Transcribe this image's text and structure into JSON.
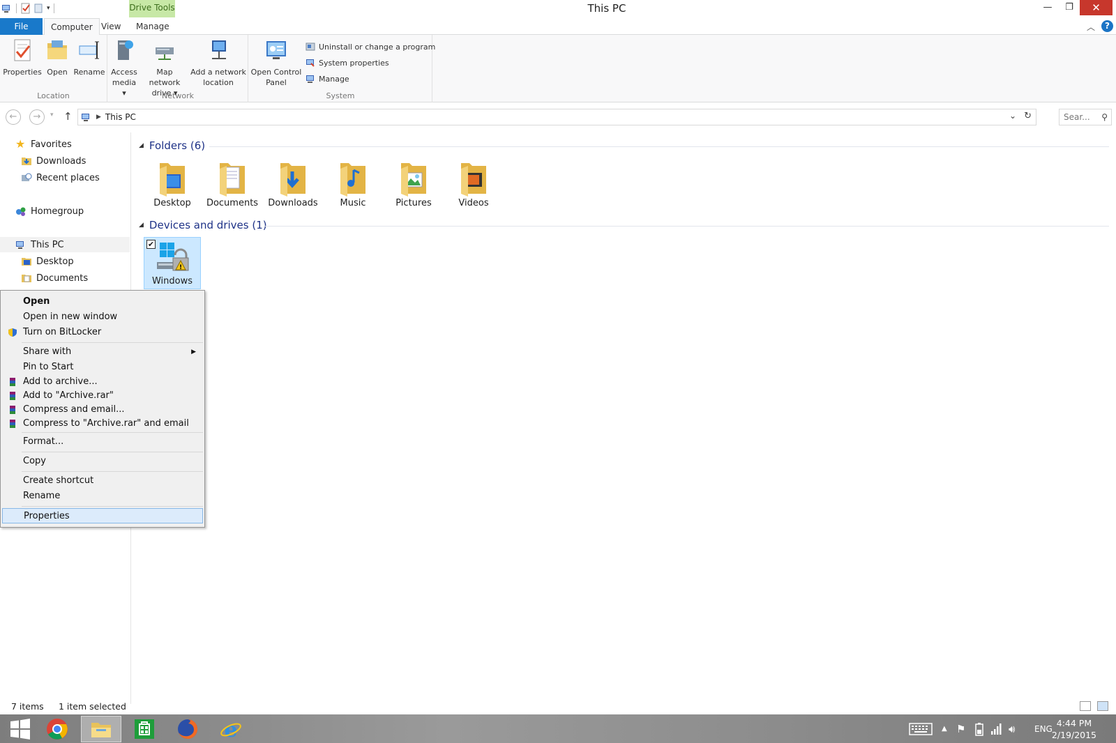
{
  "window": {
    "title": "This PC",
    "context_tab": "Drive Tools",
    "min_glyph": "—",
    "max_glyph": "❐",
    "close_glyph": "✕"
  },
  "ribbon_tabs": {
    "file": "File",
    "computer": "Computer",
    "view": "View",
    "manage": "Manage"
  },
  "ribbon": {
    "location": {
      "label": "Location",
      "properties": "Properties",
      "open": "Open",
      "rename": "Rename"
    },
    "network": {
      "label": "Network",
      "access_media_1": "Access",
      "access_media_2": "media ▾",
      "map_drive_1": "Map network",
      "map_drive_2": "drive ▾",
      "add_location_1": "Add a network",
      "add_location_2": "location"
    },
    "system": {
      "label": "System",
      "control_panel_1": "Open Control",
      "control_panel_2": "Panel",
      "uninstall": "Uninstall or change a program",
      "system_properties": "System properties",
      "manage": "Manage"
    }
  },
  "address": {
    "path": "This PC",
    "search_placeholder": "Sear..."
  },
  "nav_pane": {
    "favorites": "Favorites",
    "downloads": "Downloads",
    "recent_places": "Recent places",
    "homegroup": "Homegroup",
    "this_pc": "This PC",
    "desktop": "Desktop",
    "documents": "Documents"
  },
  "content": {
    "folders_header": "Folders (6)",
    "devices_header": "Devices and drives (1)",
    "folders": [
      "Desktop",
      "Documents",
      "Downloads",
      "Music",
      "Pictures",
      "Videos"
    ],
    "drive_label": "Windows"
  },
  "context_menu": {
    "open": "Open",
    "open_new_window": "Open in new window",
    "bitlocker": "Turn on BitLocker",
    "share_with": "Share with",
    "pin_to_start": "Pin to Start",
    "add_to_archive": "Add to archive...",
    "add_to_archive_rar": "Add to \"Archive.rar\"",
    "compress_email": "Compress and email...",
    "compress_rar_email": "Compress to \"Archive.rar\" and email",
    "format": "Format...",
    "copy": "Copy",
    "create_shortcut": "Create shortcut",
    "rename": "Rename",
    "properties": "Properties"
  },
  "status": {
    "items": "7 items",
    "selected": "1 item selected"
  },
  "taskbar": {
    "language": "ENG",
    "time": "4:44 PM",
    "date": "2/19/2015"
  },
  "colors": {
    "accent": "#1979ca",
    "drive_tools": "#c7e8a6",
    "close": "#c7372c",
    "selection": "#cce8ff"
  }
}
